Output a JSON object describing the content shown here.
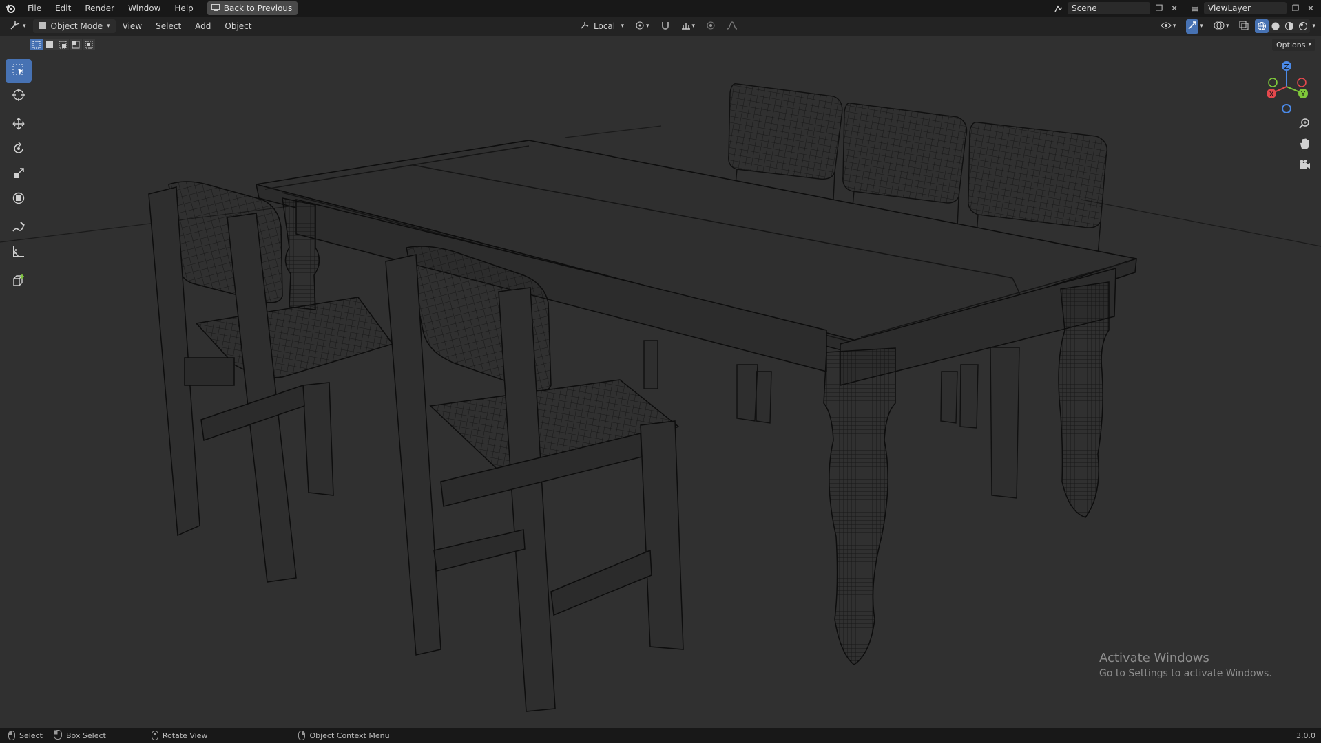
{
  "topbar": {
    "menus": [
      "File",
      "Edit",
      "Render",
      "Window",
      "Help"
    ],
    "back_button": "Back to Previous",
    "scene_name": "Scene",
    "view_layer": "ViewLayer"
  },
  "header": {
    "editor_type_icon": "3d-viewport-icon",
    "mode": "Object Mode",
    "menus": [
      "View",
      "Select",
      "Add",
      "Object"
    ],
    "transform_orientation": "Local",
    "options_label": "Options"
  },
  "toolbar": {
    "tools": [
      "select-box",
      "cursor",
      "move",
      "rotate",
      "scale",
      "transform",
      "annotate",
      "measure",
      "add-cube"
    ],
    "active_tool": "select-box"
  },
  "gizmo": {
    "x_label": "X",
    "y_label": "Y",
    "z_label": "Z",
    "colors": {
      "x": "#e5484d",
      "y": "#7fc93a",
      "z": "#4b8ae8"
    }
  },
  "watermark": {
    "title": "Activate Windows",
    "subtitle": "Go to Settings to activate Windows."
  },
  "statusbar": {
    "select": "Select",
    "box_select": "Box Select",
    "rotate_view": "Rotate View",
    "context_menu": "Object Context Menu",
    "version": "3.0.0"
  },
  "theme": {
    "accent": "#4772b3",
    "viewport_bg": "#303030",
    "wire": "#0f0f0f"
  }
}
